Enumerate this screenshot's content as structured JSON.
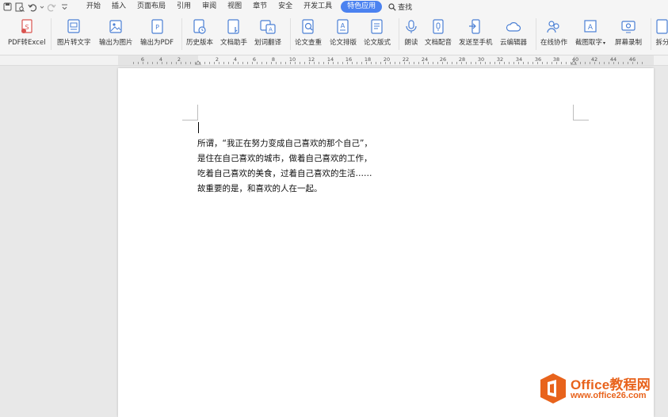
{
  "menubar": {
    "tabs": [
      "开始",
      "插入",
      "页面布局",
      "引用",
      "审阅",
      "视图",
      "章节",
      "安全",
      "开发工具",
      "特色应用"
    ],
    "active_tab": "特色应用",
    "search_label": "查找"
  },
  "ribbon": {
    "items": [
      {
        "label": "PDF转Excel",
        "icon": "pdf-excel-icon"
      },
      {
        "label": "图片转文字",
        "icon": "image-to-text-icon"
      },
      {
        "label": "输出为图片",
        "icon": "export-image-icon"
      },
      {
        "label": "输出为PDF",
        "icon": "export-pdf-icon"
      },
      {
        "label": "历史版本",
        "icon": "history-icon"
      },
      {
        "label": "文档助手",
        "icon": "doc-assistant-icon"
      },
      {
        "label": "划词翻译",
        "icon": "translate-icon"
      },
      {
        "label": "论文查重",
        "icon": "paper-check-icon"
      },
      {
        "label": "论文排版",
        "icon": "paper-layout-icon"
      },
      {
        "label": "论文版式",
        "icon": "paper-format-icon"
      },
      {
        "label": "朗读",
        "icon": "read-aloud-icon"
      },
      {
        "label": "文档配音",
        "icon": "doc-dubbing-icon"
      },
      {
        "label": "发送至手机",
        "icon": "send-to-phone-icon"
      },
      {
        "label": "云编辑器",
        "icon": "cloud-editor-icon"
      },
      {
        "label": "在线协作",
        "icon": "online-collab-icon"
      },
      {
        "label": "截图取字",
        "icon": "screenshot-text-icon"
      },
      {
        "label": "屏幕录制",
        "icon": "screen-record-icon"
      },
      {
        "label": "拆分",
        "icon": "split-icon"
      }
    ]
  },
  "ruler": {
    "numbers": [
      "6",
      "4",
      "2",
      "2",
      "4",
      "6",
      "8",
      "10",
      "12",
      "14",
      "16",
      "18",
      "20",
      "22",
      "24",
      "26",
      "28",
      "30",
      "32",
      "34",
      "36",
      "38",
      "40",
      "42",
      "44",
      "46"
    ]
  },
  "document": {
    "lines": [
      "所谓，“我正在努力变成自己喜欢的那个自己”，",
      "是住在自己喜欢的城市，做着自己喜欢的工作，",
      "吃着自己喜欢的美食，过着自己喜欢的生活……",
      "故重要的是，和喜欢的人在一起。"
    ]
  },
  "watermark": {
    "title": "Office教程网",
    "url": "www.office26.com"
  },
  "colors": {
    "accent": "#4b82f0",
    "watermark": "#e8631c",
    "ribbon_icon": "#4a7fd4"
  }
}
